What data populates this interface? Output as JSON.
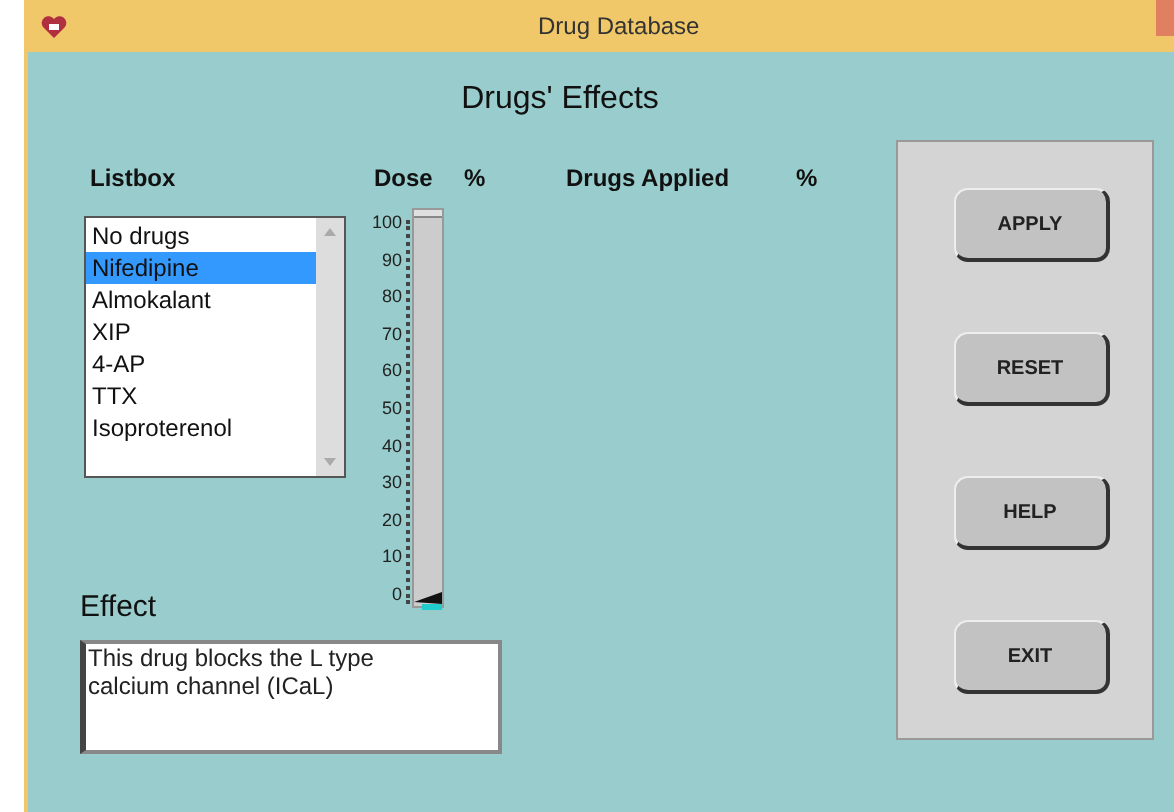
{
  "window": {
    "title": "Drug Database"
  },
  "heading": "Drugs' Effects",
  "columns": [
    "Listbox",
    "Dose",
    "%",
    "Drugs Applied",
    "%"
  ],
  "listbox": {
    "items": [
      {
        "label": "No drugs",
        "selected": false
      },
      {
        "label": "Nifedipine",
        "selected": true
      },
      {
        "label": "Almokalant",
        "selected": false
      },
      {
        "label": "XIP",
        "selected": false
      },
      {
        "label": "4-AP",
        "selected": false
      },
      {
        "label": "TTX",
        "selected": false
      },
      {
        "label": "Isoproterenol",
        "selected": false
      }
    ]
  },
  "dose_slider": {
    "ticks": [
      "100",
      "90",
      "80",
      "70",
      "60",
      "50",
      "40",
      "30",
      "20",
      "10",
      "0"
    ],
    "level": 0
  },
  "effect": {
    "label": "Effect",
    "text": "This drug blocks the L type calcium channel (ICaL)"
  },
  "buttons": [
    "APPLY",
    "RESET",
    "HELP",
    "EXIT"
  ]
}
